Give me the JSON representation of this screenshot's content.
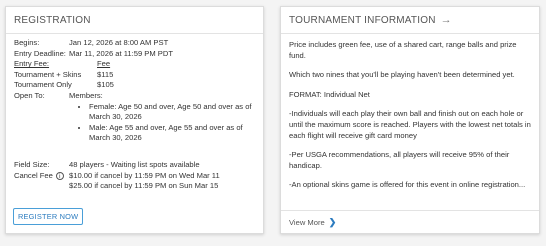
{
  "registration": {
    "title": "REGISTRATION",
    "begins_label": "Begins:",
    "begins_value": "Jan 12, 2026 at 8:00 AM PST",
    "deadline_label": "Entry Deadline:",
    "deadline_value": "Mar 11, 2026 at 11:59 PM PDT",
    "entry_fee_label": "Entry Fee:",
    "fee_col_label": "Fee",
    "fees": [
      {
        "name": "Tournament + Skins",
        "amount": "$115"
      },
      {
        "name": "Tournament Only",
        "amount": "$105"
      }
    ],
    "open_to_label": "Open To:",
    "members_label": "Members:",
    "members": [
      "Female: Age 50 and over, Age 50 and over as of March 30, 2026",
      "Male: Age 55 and over, Age 55 and over as of March 30, 2026"
    ],
    "field_size_label": "Field Size:",
    "field_size_value": "48 players - Waiting list spots available",
    "cancel_fee_label": "Cancel Fee",
    "cancel_fees": [
      "$10.00 if cancel by 11:59 PM on Wed Mar 11",
      "$25.00 if cancel by 11:59 PM on Sun Mar 15"
    ],
    "register_button": "REGISTER NOW"
  },
  "info": {
    "title": "TOURNAMENT INFORMATION",
    "arrow": "→",
    "paragraphs": [
      "Price includes green fee, use of a shared cart, range balls and prize fund.",
      "Which two nines that you'll be playing haven't been determined yet.",
      "FORMAT: Individual Net",
      "-Individuals will each play their own ball and finish out on each hole or until the maximum score is reached. Players with the lowest net totals in each flight will receive gift card money",
      "-Per USGA recommendations, all players will receive 95% of their handicap.",
      "-An optional skins game is offered for this event in online registration..."
    ],
    "view_more": "View More",
    "view_more_icon": "chevron-right-icon"
  }
}
